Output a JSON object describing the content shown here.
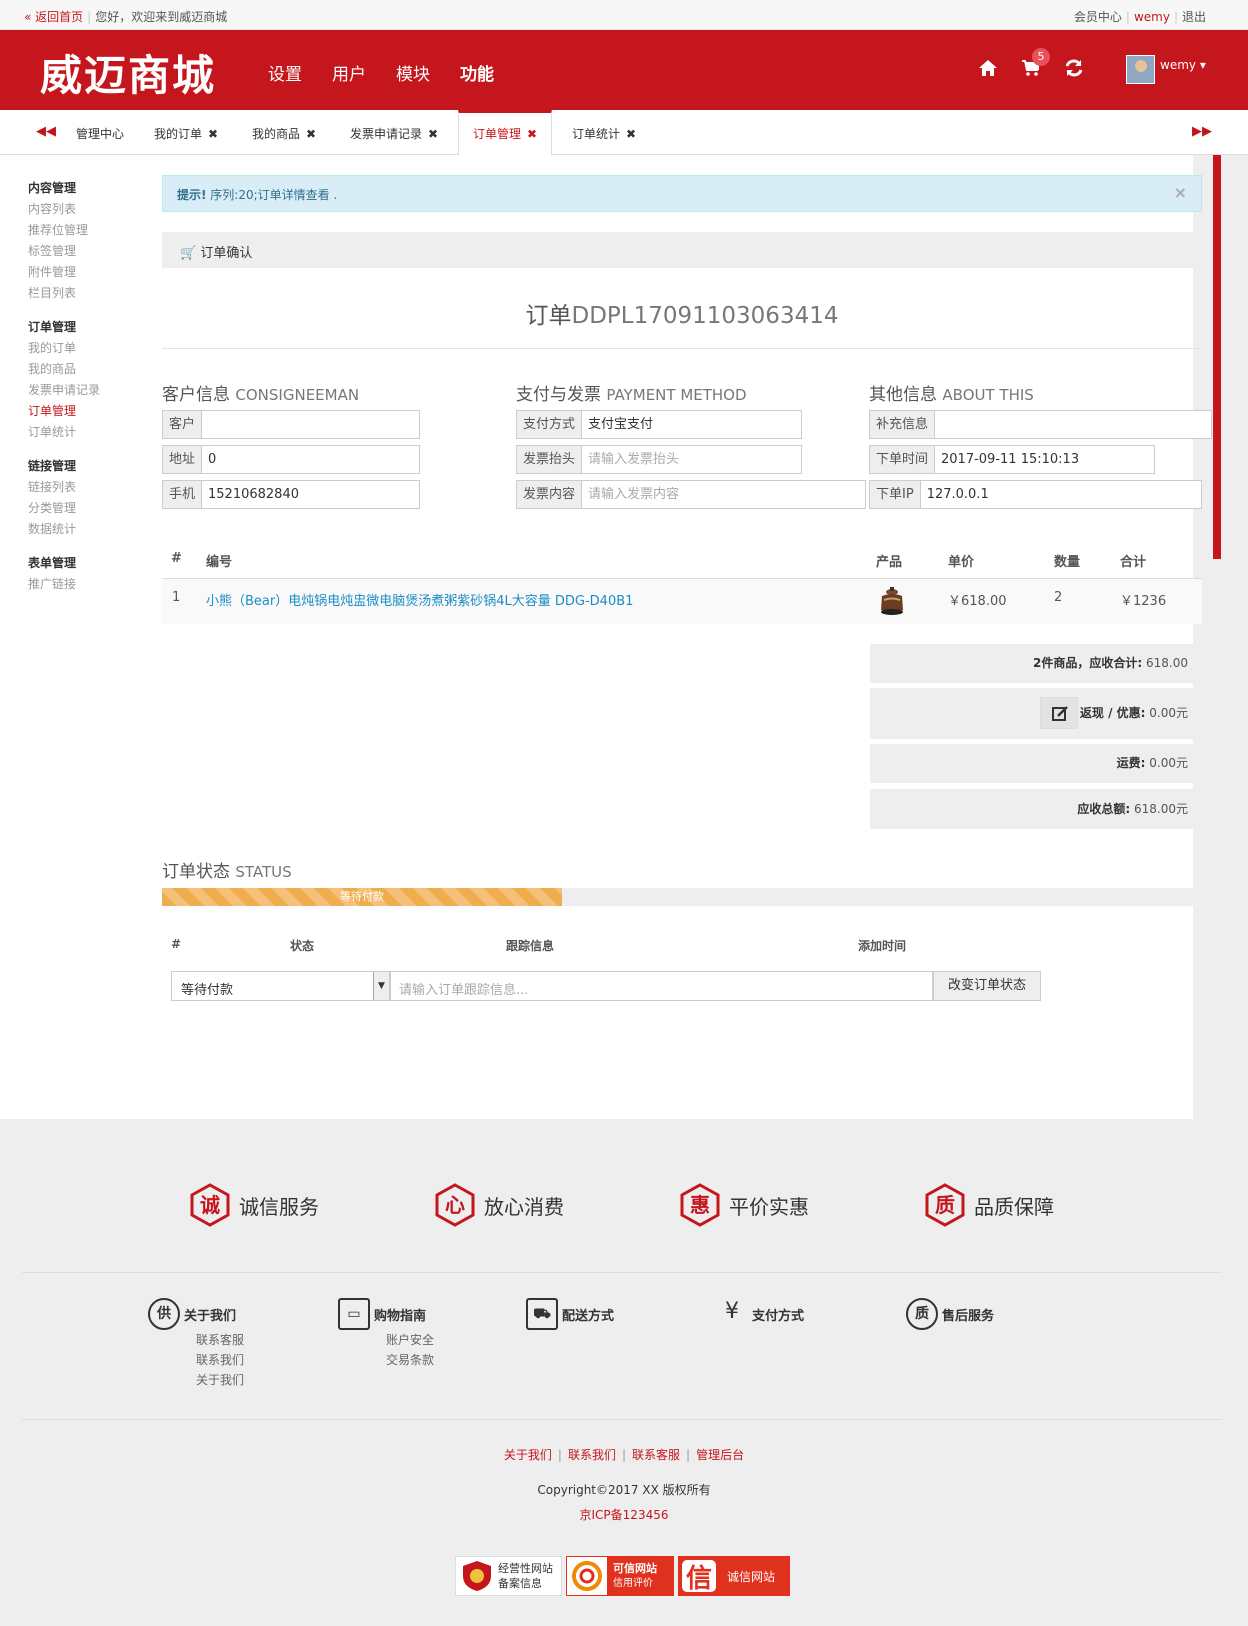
{
  "topbar": {
    "back_home": "« 返回首页",
    "welcome": "您好，欢迎来到威迈商城",
    "member_center": "会员中心",
    "username": "wemy",
    "logout": "退出"
  },
  "header": {
    "logo": "威迈商城",
    "nav": [
      "设置",
      "用户",
      "模块",
      "功能"
    ],
    "cart_count": "5",
    "user": "wemy"
  },
  "tabs": [
    {
      "label": "管理中心",
      "closable": false
    },
    {
      "label": "我的订单",
      "closable": true
    },
    {
      "label": "我的商品",
      "closable": true
    },
    {
      "label": "发票申请记录",
      "closable": true
    },
    {
      "label": "订单管理",
      "closable": true
    },
    {
      "label": "订单统计",
      "closable": true
    }
  ],
  "sidebar": {
    "groups": [
      {
        "title": "内容管理",
        "items": [
          "内容列表",
          "推荐位管理",
          "标签管理",
          "附件管理",
          "栏目列表"
        ]
      },
      {
        "title": "订单管理",
        "items": [
          "我的订单",
          "我的商品",
          "发票申请记录",
          "订单管理",
          "订单统计"
        ]
      },
      {
        "title": "链接管理",
        "items": [
          "链接列表",
          "分类管理",
          "数据统计"
        ]
      },
      {
        "title": "表单管理",
        "items": [
          "推广链接"
        ]
      }
    ]
  },
  "alert": {
    "strong": "提示!",
    "text": " 序列:20;订单详情查看 ."
  },
  "confirm": {
    "label": "订单确认"
  },
  "order": {
    "title_prefix": "订单",
    "number": "DDPL17091103063414"
  },
  "customer": {
    "title": "客户信息",
    "title_en": "CONSIGNEEMAN",
    "customer_label": "客户",
    "customer_value": "",
    "address_label": "地址",
    "address_value": "0",
    "phone_label": "手机",
    "phone_value": "15210682840"
  },
  "payment": {
    "title": "支付与发票",
    "title_en": "PAYMENT METHOD",
    "method_label": "支付方式",
    "method_value": "支付宝支付",
    "invoice_title_label": "发票抬头",
    "invoice_title_placeholder": "请输入发票抬头",
    "invoice_content_label": "发票内容",
    "invoice_content_placeholder": "请输入发票内容"
  },
  "other": {
    "title": "其他信息",
    "title_en": "ABOUT THIS",
    "extra_label": "补充信息",
    "extra_value": "",
    "time_label": "下单时间",
    "time_value": "2017-09-11 15:10:13",
    "ip_label": "下单IP",
    "ip_value": "127.0.0.1"
  },
  "items_table": {
    "headers": [
      "#",
      "编号",
      "产品",
      "单价",
      "数量",
      "合计"
    ],
    "rows": [
      {
        "index": "1",
        "name": "小熊（Bear）电炖锅电炖盅微电脑煲汤煮粥紫砂锅4L大容量 DDG-D40B1",
        "price": "￥618.00",
        "qty": "2",
        "total": "￥1236"
      }
    ]
  },
  "summary": {
    "count_label": "2件商品，应收合计:",
    "count_value": "618.00",
    "discount_label": "返现 / 优惠:",
    "discount_value": "0.00元",
    "shipping_label": "运费:",
    "shipping_value": "0.00元",
    "total_label": "应收总额:",
    "total_value": "618.00元"
  },
  "status": {
    "title": "订单状态",
    "title_en": "STATUS",
    "progress_label": "等待付款",
    "progress": 0.385,
    "headers": [
      "#",
      "状态",
      "跟踪信息",
      "添加时间"
    ],
    "select_value": "等待付款",
    "track_placeholder": "请输入订单跟踪信息...",
    "button": "改变订单状态"
  },
  "footer": {
    "promos": [
      {
        "char": "诚",
        "label": "诚信服务"
      },
      {
        "char": "心",
        "label": "放心消费"
      },
      {
        "char": "惠",
        "label": "平价实惠"
      },
      {
        "char": "质",
        "label": "品质保障"
      }
    ],
    "columns": [
      {
        "icon": "供",
        "title": "关于我们",
        "links": [
          "联系客服",
          "联系我们",
          "关于我们"
        ]
      },
      {
        "icon": "▭",
        "title": "购物指南",
        "links": [
          "账户安全",
          "交易条款"
        ]
      },
      {
        "icon": "⛟",
        "title": "配送方式",
        "links": []
      },
      {
        "icon": "¥",
        "title": "支付方式",
        "links": []
      },
      {
        "icon": "质",
        "title": "售后服务",
        "links": []
      }
    ],
    "links": [
      "关于我们",
      "联系我们",
      "联系客服",
      "管理后台"
    ],
    "copyright": "Copyright©2017 XX 版权所有",
    "icp": "京ICP备123456",
    "badges": [
      {
        "line1": "经营性网站",
        "line2": "备案信息"
      },
      {
        "line1": "可信网站",
        "line2": "信用评价"
      },
      {
        "line1": "诚信网站",
        "line2": ""
      }
    ]
  },
  "colors": {
    "brand": "#c4161c",
    "info_bg": "#d9edf7",
    "link": "#1a8dc8",
    "progress": "#f0ad4e"
  }
}
